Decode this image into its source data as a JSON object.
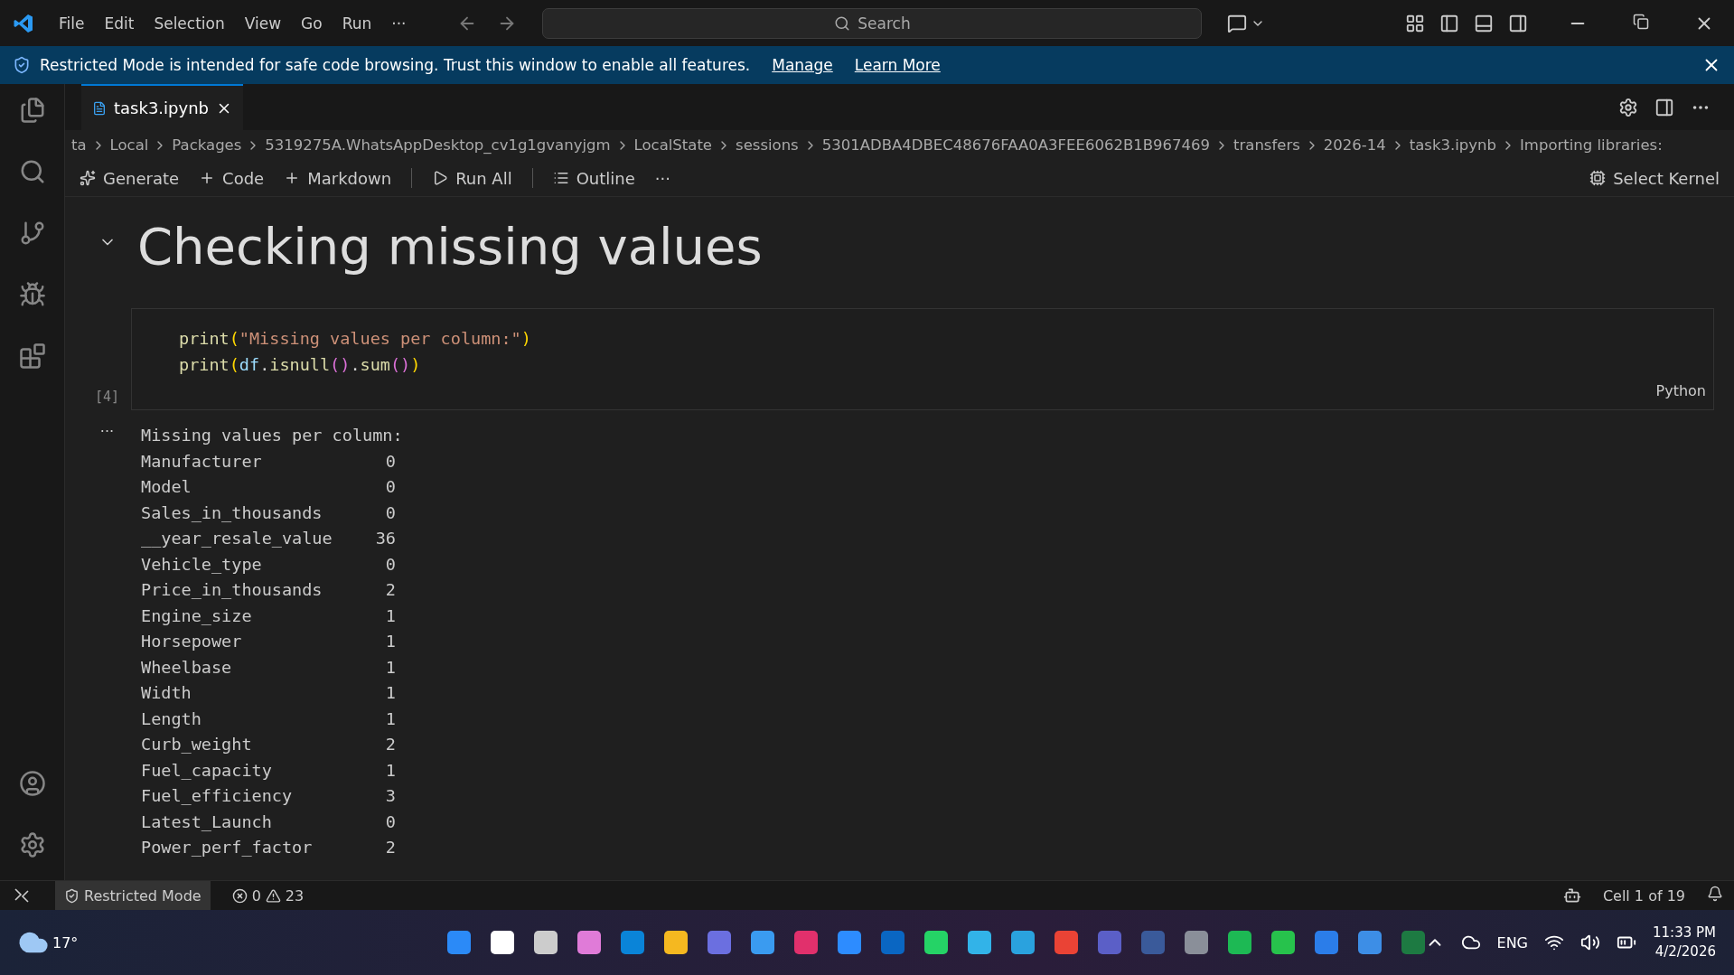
{
  "menu": [
    "File",
    "Edit",
    "Selection",
    "View",
    "Go",
    "Run",
    "···"
  ],
  "search": {
    "placeholder": "Search"
  },
  "banner": {
    "message": "Restricted Mode is intended for safe code browsing. Trust this window to enable all features.",
    "links": [
      "Manage",
      "Learn More"
    ]
  },
  "tabs": [
    {
      "label": "task3.ipynb",
      "selected": true
    }
  ],
  "breadcrumb": [
    "ta",
    "Local",
    "Packages",
    "5319275A.WhatsAppDesktop_cv1g1gvanyjgm",
    "LocalState",
    "sessions",
    "5301ADBA4DBEC48676FAA0A3FEE6062B1B967469",
    "transfers",
    "2026-14",
    "task3.ipynb",
    "Importing libraries:"
  ],
  "toolbar": [
    {
      "kind": "sparkle",
      "label": "Generate"
    },
    {
      "kind": "plus",
      "label": "Code"
    },
    {
      "kind": "plus",
      "label": "Markdown"
    },
    {
      "kind": "sep"
    },
    {
      "kind": "run",
      "label": "Run All"
    },
    {
      "kind": "sep"
    },
    {
      "kind": "outline",
      "label": "Outline"
    },
    {
      "kind": "more",
      "label": "···"
    }
  ],
  "kernel": "Select Kernel",
  "heading": "Checking missing values",
  "cell": {
    "exec_count": "[4]",
    "language": "Python",
    "lines": [
      [
        {
          "kind": "fn",
          "text": "print"
        },
        {
          "kind": "p1",
          "text": "("
        },
        {
          "kind": "str",
          "text": "\"Missing values per column:\""
        },
        {
          "kind": "p1",
          "text": ")"
        }
      ],
      [
        {
          "kind": "fn",
          "text": "print"
        },
        {
          "kind": "p1",
          "text": "("
        },
        {
          "kind": "var",
          "text": "df"
        },
        {
          "kind": "plain",
          "text": "."
        },
        {
          "kind": "fn",
          "text": "isnull"
        },
        {
          "kind": "p2",
          "text": "()"
        },
        {
          "kind": "plain",
          "text": "."
        },
        {
          "kind": "fn",
          "text": "sum"
        },
        {
          "kind": "p2",
          "text": "()"
        },
        {
          "kind": "p1",
          "text": ")"
        }
      ]
    ]
  },
  "output": {
    "more": "···",
    "header": "Missing values per column:",
    "rows": [
      {
        "name": "Manufacturer",
        "value": "0"
      },
      {
        "name": "Model",
        "value": "0"
      },
      {
        "name": "Sales_in_thousands",
        "value": "0"
      },
      {
        "name": "__year_resale_value",
        "value": "36"
      },
      {
        "name": "Vehicle_type",
        "value": "0"
      },
      {
        "name": "Price_in_thousands",
        "value": "2"
      },
      {
        "name": "Engine_size",
        "value": "1"
      },
      {
        "name": "Horsepower",
        "value": "1"
      },
      {
        "name": "Wheelbase",
        "value": "1"
      },
      {
        "name": "Width",
        "value": "1"
      },
      {
        "name": "Length",
        "value": "1"
      },
      {
        "name": "Curb_weight",
        "value": "2"
      },
      {
        "name": "Fuel_capacity",
        "value": "1"
      },
      {
        "name": "Fuel_efficiency",
        "value": "3"
      },
      {
        "name": "Latest_Launch",
        "value": "0"
      },
      {
        "name": "Power_perf_factor",
        "value": "2"
      }
    ]
  },
  "status_bar": {
    "mode": "Restricted Mode",
    "errors": "0",
    "warnings": "23",
    "cell": "Cell 1 of 19"
  },
  "taskbar": {
    "weather": "17°",
    "lang": "ENG",
    "time": "11:33 PM",
    "date": "4/2/2026"
  }
}
